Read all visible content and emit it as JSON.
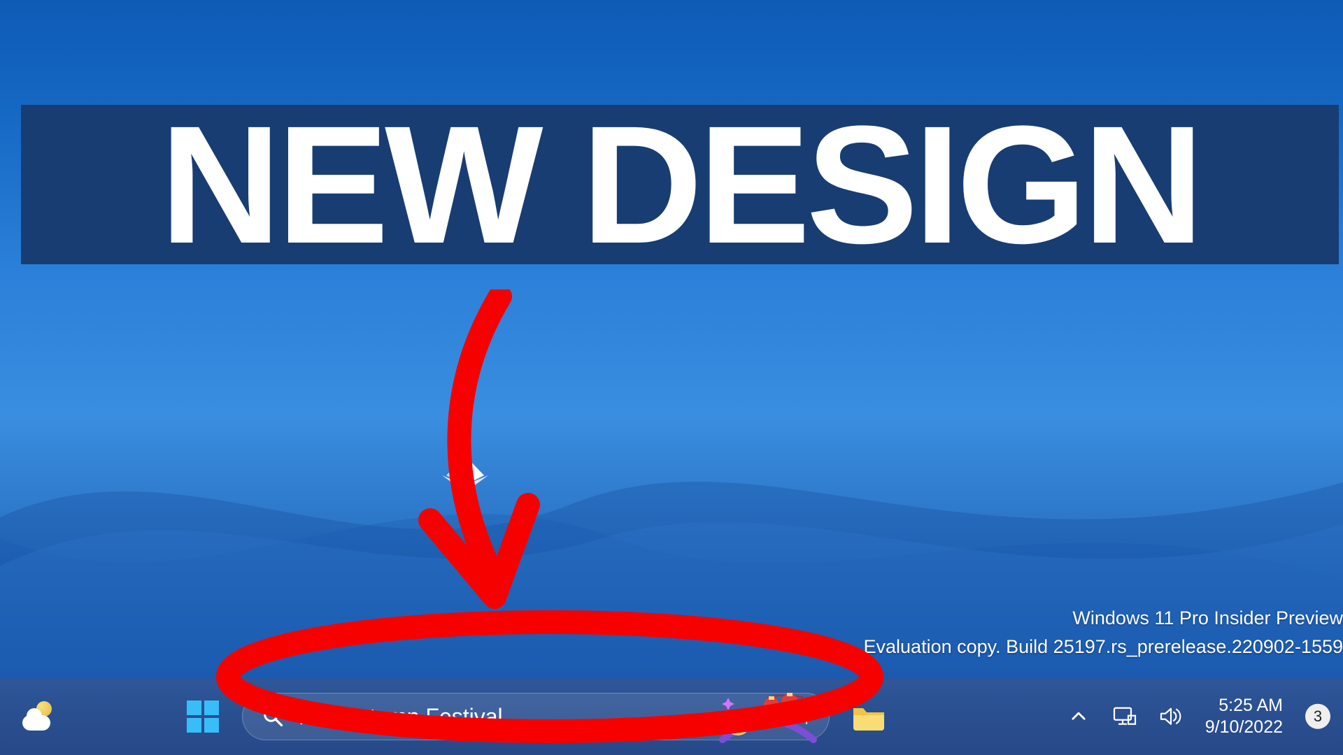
{
  "headline": {
    "text": "NEW DESIGN"
  },
  "watermark": {
    "line1": "Windows 11 Pro Insider Preview",
    "line2": "Evaluation copy. Build 25197.rs_prerelease.220902-1559"
  },
  "taskbar": {
    "search_placeholder": "Mid-Autumn Festival",
    "time": "5:25 AM",
    "date": "9/10/2022",
    "notification_count": "3"
  },
  "colors": {
    "annotation_red": "#f70000",
    "banner_bg": "#183d73"
  }
}
